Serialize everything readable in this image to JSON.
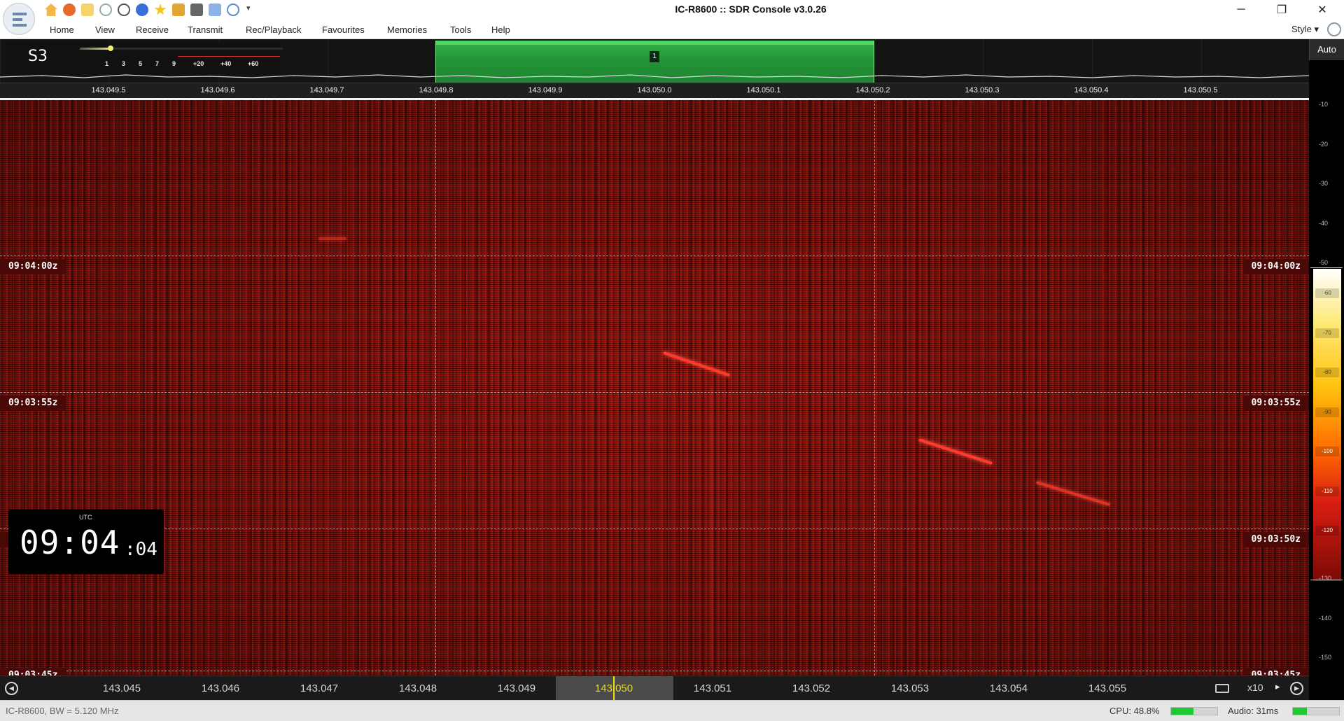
{
  "window": {
    "title": "IC-R8600 :: SDR Console v3.0.26"
  },
  "quick_access": [
    "home-icon",
    "tools-icon",
    "folder-icon",
    "play-icon",
    "stop-icon",
    "record-icon",
    "favourite-star-icon",
    "lock-icon",
    "camera-icon",
    "user-icon",
    "undo-icon"
  ],
  "menu": {
    "items": [
      "Home",
      "View",
      "Receive",
      "Transmit",
      "Rec/Playback",
      "Favourites",
      "Memories",
      "Tools",
      "Help"
    ],
    "style_label": "Style"
  },
  "spectrum": {
    "smeter_reading": "S3",
    "smeter_level": 0.15,
    "smeter_scale": [
      "1",
      "3",
      "5",
      "7",
      "9",
      "+20",
      "+40",
      "+60"
    ],
    "vfo_number": "1",
    "freq_ticks": [
      "143.049.5",
      "143.049.6",
      "143.049.7",
      "143.049.8",
      "143.049.9",
      "143.050.0",
      "143.050.1",
      "143.050.2",
      "143.050.3",
      "143.050.4",
      "143.050.5"
    ]
  },
  "db_scale": {
    "auto_label": "Auto",
    "labels": [
      "-10",
      "-20",
      "-30",
      "-40",
      "-50",
      "-60",
      "-70",
      "-80",
      "-90",
      "-100",
      "-110",
      "-120",
      "-130",
      "-140",
      "-150"
    ]
  },
  "waterfall": {
    "time_labels": [
      "09:04:00z",
      "09:03:55z",
      "09:03:50z",
      "09:03:45z"
    ],
    "clock": {
      "tz": "UTC",
      "hm": "09:04",
      "sec": ":04"
    }
  },
  "bottom_scale": {
    "ticks": [
      "143.045",
      "143.046",
      "143.047",
      "143.048",
      "143.049",
      "143.050",
      "143.051",
      "143.052",
      "143.053",
      "143.054",
      "143.055"
    ],
    "zoom": "x10"
  },
  "status": {
    "device": "IC-R8600, BW = 5.120 MHz",
    "cpu": "CPU: 48.8%",
    "cpu_level": 0.488,
    "audio": "Audio: 31ms",
    "audio_level": 0.31
  },
  "colors": {
    "passband": "#239436",
    "waterfall": "#7a110b",
    "cursor": "#f2e100"
  }
}
